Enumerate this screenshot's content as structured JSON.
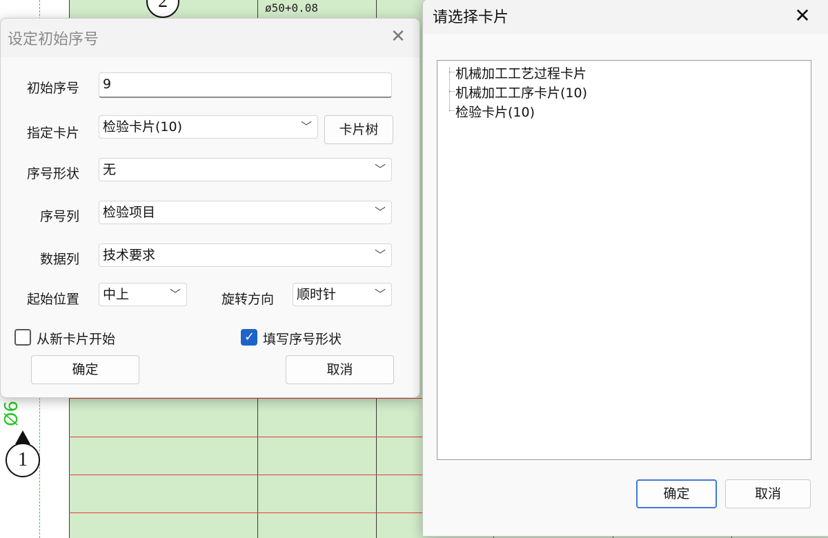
{
  "background": {
    "circle_top_label": "2",
    "tolerance_text": "ø50+0.08",
    "circle_bottom_label": "1",
    "green_dimension_text": "Ø6"
  },
  "dialog_set_start": {
    "title": "设定初始序号",
    "start_number_label": "初始序号",
    "start_number_value": "9",
    "card_label": "指定卡片",
    "card_value": "检验卡片(10)",
    "card_tree_button": "卡片树",
    "number_shape_label": "序号形状",
    "number_shape_value": "无",
    "number_column_label": "序号列",
    "number_column_value": "检验项目",
    "data_column_label": "数据列",
    "data_column_value": "技术要求",
    "start_position_label": "起始位置",
    "start_position_value": "中上",
    "rotation_label": "旋转方向",
    "rotation_value": "顺时针",
    "new_card_checkbox_label": "从新卡片开始",
    "new_card_checked": false,
    "fill_shape_checkbox_label": "填写序号形状",
    "fill_shape_checked": true,
    "ok_button": "确定",
    "cancel_button": "取消"
  },
  "dialog_select_card": {
    "title": "请选择卡片",
    "items": [
      "机械加工工艺过程卡片",
      "机械加工工序卡片(10)",
      "检验卡片(10)"
    ],
    "ok_button": "确定",
    "cancel_button": "取消"
  },
  "colors": {
    "drawing_background": "#d2ebc9",
    "grid_red": "#e8393f",
    "accent_blue": "#1d63c9"
  }
}
